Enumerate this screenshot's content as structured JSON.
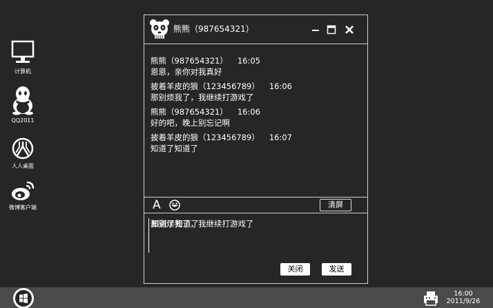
{
  "desktop": {
    "icons": [
      {
        "label": "计算机",
        "icon": "computer-icon"
      },
      {
        "label": "QQ2011",
        "icon": "qq-penguin-icon"
      },
      {
        "label": "人人桌面",
        "icon": "renren-icon"
      },
      {
        "label": "微博客户端",
        "icon": "weibo-icon"
      }
    ]
  },
  "chat": {
    "title": "熊熊（987654321）",
    "avatar_icon": "panda-avatar-icon",
    "window_controls": [
      "minimize-icon",
      "maximize-icon",
      "close-icon"
    ],
    "messages": [
      {
        "sender": "熊熊（987654321）",
        "time": "16:05",
        "text": "恩恩，亲你对我真好"
      },
      {
        "sender": "披着羊皮的狼（123456789）",
        "time": "16:06",
        "text": "那别烦我了，我继续打游戏了"
      },
      {
        "sender": "熊熊（987654321）",
        "time": "16:06",
        "text": "好的吧，晚上别忘记啊"
      },
      {
        "sender": "披着羊皮的狼（123456789）",
        "time": "16:07",
        "text": "知道了知道了"
      }
    ],
    "toolbar": {
      "font_label": "A",
      "emoji_icon": "smiley-icon",
      "clear_label": "清屏"
    },
    "input_text": "那别烦我了，我继续打游戏了",
    "input_overlay_text": "知道了知道了",
    "close_label": "关闭",
    "send_label": "发送"
  },
  "taskbar": {
    "start_icon": "windows-start-icon",
    "tray_icon": "printer-icon",
    "time": "16:00",
    "date": "2011/9/26"
  },
  "colors": {
    "background": "#262626",
    "taskbar": "#4a4a4a",
    "foreground": "#ffffff",
    "border": "#d0d0d0"
  }
}
